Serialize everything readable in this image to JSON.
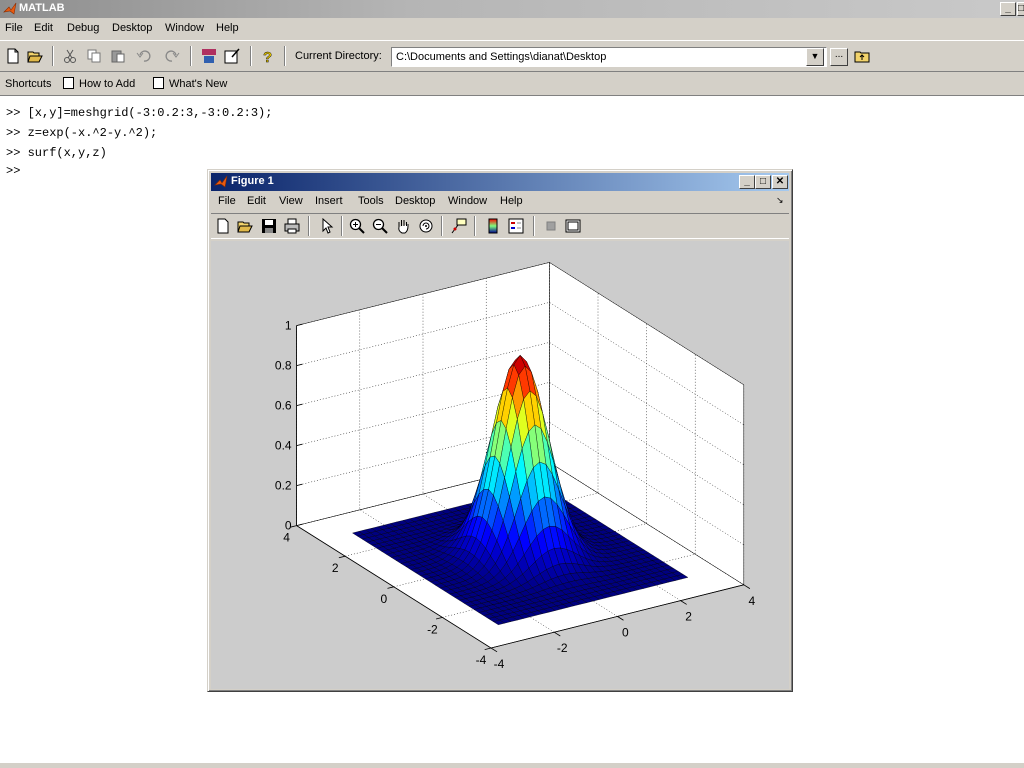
{
  "main_window": {
    "title": "MATLAB",
    "controls": {
      "minimize": "_",
      "restore": "□"
    },
    "menu": [
      "File",
      "Edit",
      "Debug",
      "Desktop",
      "Window",
      "Help"
    ],
    "toolbar": {
      "current_directory_label": "Current Directory:",
      "current_directory_value": "C:\\Documents and Settings\\dianat\\Desktop",
      "browse_label": "..."
    },
    "shortcuts": {
      "label": "Shortcuts",
      "items": [
        "How to Add",
        "What's New"
      ]
    }
  },
  "command_window": {
    "lines": [
      ">> [x,y]=meshgrid(-3:0.2:3,-3:0.2:3);",
      ">> z=exp(-x.^2-y.^2);",
      ">> surf(x,y,z)",
      ">>"
    ]
  },
  "figure_window": {
    "title": "Figure 1",
    "controls": {
      "minimize": "_",
      "maximize": "□",
      "close": "✕"
    },
    "menu": [
      "File",
      "Edit",
      "View",
      "Insert",
      "Tools",
      "Desktop",
      "Window",
      "Help"
    ],
    "dock_glyph": "↘"
  },
  "chart_data": {
    "type": "surface",
    "function": "z = exp(-x^2 - y^2)",
    "x": {
      "start": -3,
      "step": 0.2,
      "end": 3
    },
    "y": {
      "start": -3,
      "step": 0.2,
      "end": 3
    },
    "xlim": [
      -4,
      4
    ],
    "ylim": [
      -4,
      4
    ],
    "zlim": [
      0,
      1
    ],
    "xticks": [
      "-4",
      "-2",
      "0",
      "2",
      "4"
    ],
    "yticks": [
      "-4",
      "-2",
      "0",
      "2",
      "4"
    ],
    "zticks": [
      "0",
      "0.2",
      "0.4",
      "0.6",
      "0.8",
      "1"
    ],
    "colormap": "jet",
    "grid": true,
    "axes_color": "#ffffff",
    "figure_color": "#cccccc"
  },
  "colors": {
    "dialog_gray": "#d4d0c8",
    "active_title_start": "#0a246a",
    "active_title_end": "#a6caf0",
    "edge_color": "#000000"
  }
}
